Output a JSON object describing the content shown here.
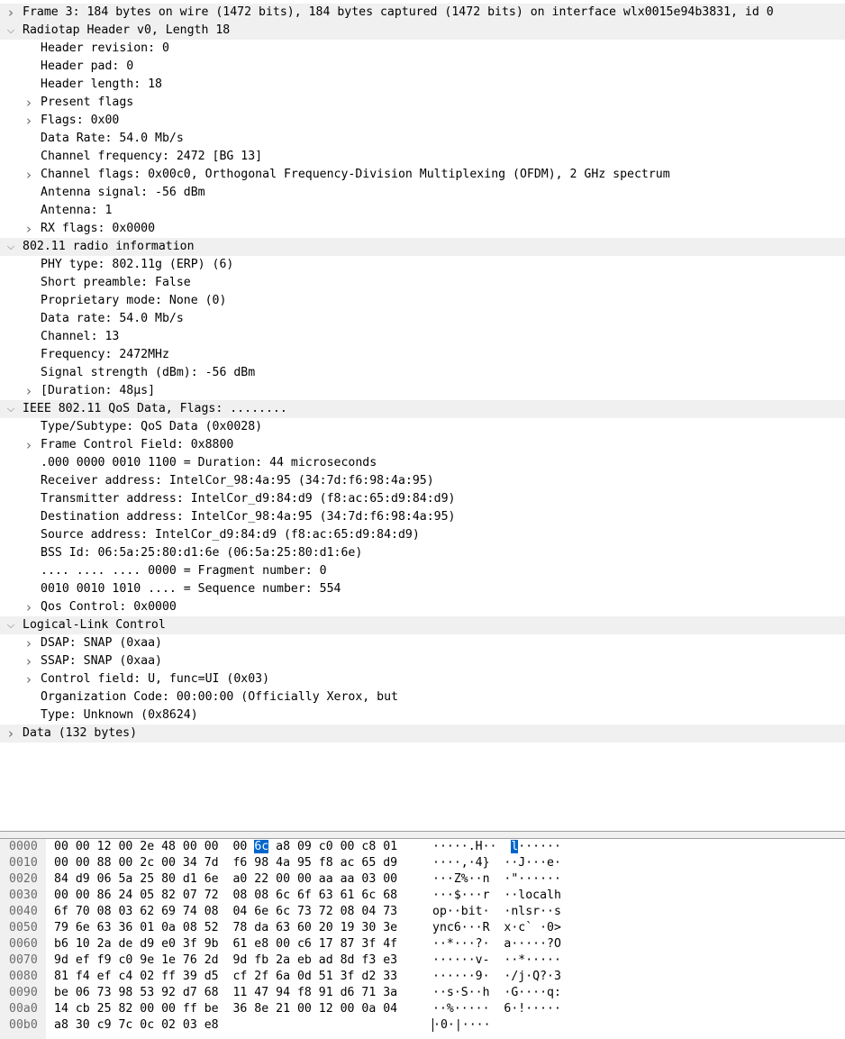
{
  "detail_pane": {
    "rows": [
      {
        "indent": 0,
        "arrow": "collapsed",
        "text": "Frame 3: 184 bytes on wire (1472 bits), 184 bytes captured (1472 bits) on interface wlx0015e94b3831, id 0"
      },
      {
        "indent": 0,
        "arrow": "expanded",
        "text": "Radiotap Header v0, Length 18"
      },
      {
        "indent": 1,
        "arrow": "none",
        "text": "Header revision: 0"
      },
      {
        "indent": 1,
        "arrow": "none",
        "text": "Header pad: 0"
      },
      {
        "indent": 1,
        "arrow": "none",
        "text": "Header length: 18"
      },
      {
        "indent": 1,
        "arrow": "collapsed",
        "text": "Present flags"
      },
      {
        "indent": 1,
        "arrow": "collapsed",
        "text": "Flags: 0x00"
      },
      {
        "indent": 1,
        "arrow": "none",
        "text": "Data Rate: 54.0 Mb/s"
      },
      {
        "indent": 1,
        "arrow": "none",
        "text": "Channel frequency: 2472 [BG 13]"
      },
      {
        "indent": 1,
        "arrow": "collapsed",
        "text": "Channel flags: 0x00c0, Orthogonal Frequency-Division Multiplexing (OFDM), 2 GHz spectrum"
      },
      {
        "indent": 1,
        "arrow": "none",
        "text": "Antenna signal: -56 dBm"
      },
      {
        "indent": 1,
        "arrow": "none",
        "text": "Antenna: 1"
      },
      {
        "indent": 1,
        "arrow": "collapsed",
        "text": "RX flags: 0x0000"
      },
      {
        "indent": 0,
        "arrow": "expanded",
        "text": "802.11 radio information"
      },
      {
        "indent": 1,
        "arrow": "none",
        "text": "PHY type: 802.11g (ERP) (6)"
      },
      {
        "indent": 1,
        "arrow": "none",
        "text": "Short preamble: False"
      },
      {
        "indent": 1,
        "arrow": "none",
        "text": "Proprietary mode: None (0)"
      },
      {
        "indent": 1,
        "arrow": "none",
        "text": "Data rate: 54.0 Mb/s"
      },
      {
        "indent": 1,
        "arrow": "none",
        "text": "Channel: 13"
      },
      {
        "indent": 1,
        "arrow": "none",
        "text": "Frequency: 2472MHz"
      },
      {
        "indent": 1,
        "arrow": "none",
        "text": "Signal strength (dBm): -56 dBm"
      },
      {
        "indent": 1,
        "arrow": "collapsed",
        "text": "[Duration: 48µs]"
      },
      {
        "indent": 0,
        "arrow": "expanded",
        "text": "IEEE 802.11 QoS Data, Flags: ........"
      },
      {
        "indent": 1,
        "arrow": "none",
        "text": "Type/Subtype: QoS Data (0x0028)"
      },
      {
        "indent": 1,
        "arrow": "collapsed",
        "text": "Frame Control Field: 0x8800"
      },
      {
        "indent": 1,
        "arrow": "none",
        "text": ".000 0000 0010 1100 = Duration: 44 microseconds"
      },
      {
        "indent": 1,
        "arrow": "none",
        "text": "Receiver address: IntelCor_98:4a:95 (34:7d:f6:98:4a:95)"
      },
      {
        "indent": 1,
        "arrow": "none",
        "text": "Transmitter address: IntelCor_d9:84:d9 (f8:ac:65:d9:84:d9)"
      },
      {
        "indent": 1,
        "arrow": "none",
        "text": "Destination address: IntelCor_98:4a:95 (34:7d:f6:98:4a:95)"
      },
      {
        "indent": 1,
        "arrow": "none",
        "text": "Source address: IntelCor_d9:84:d9 (f8:ac:65:d9:84:d9)"
      },
      {
        "indent": 1,
        "arrow": "none",
        "text": "BSS Id: 06:5a:25:80:d1:6e (06:5a:25:80:d1:6e)"
      },
      {
        "indent": 1,
        "arrow": "none",
        "text": ".... .... .... 0000 = Fragment number: 0"
      },
      {
        "indent": 1,
        "arrow": "none",
        "text": "0010 0010 1010 .... = Sequence number: 554"
      },
      {
        "indent": 1,
        "arrow": "collapsed",
        "text": "Qos Control: 0x0000"
      },
      {
        "indent": 0,
        "arrow": "expanded",
        "text": "Logical-Link Control"
      },
      {
        "indent": 1,
        "arrow": "collapsed",
        "text": "DSAP: SNAP (0xaa)"
      },
      {
        "indent": 1,
        "arrow": "collapsed",
        "text": "SSAP: SNAP (0xaa)"
      },
      {
        "indent": 1,
        "arrow": "collapsed",
        "text": "Control field: U, func=UI (0x03)"
      },
      {
        "indent": 1,
        "arrow": "none",
        "text": "Organization Code: 00:00:00 (Officially Xerox, but"
      },
      {
        "indent": 1,
        "arrow": "none",
        "text": "Type: Unknown (0x8624)"
      },
      {
        "indent": 0,
        "arrow": "collapsed",
        "text": "Data (132 bytes)"
      }
    ]
  },
  "bytes_pane": {
    "rows": [
      {
        "offset": "0000",
        "hex": [
          "00 00 12 00 2e 48 00 00  00 ",
          "6c",
          " a8 09 c0 00 c8 01"
        ],
        "ascii": [
          "·····.H··  ",
          "l",
          "······"
        ]
      },
      {
        "offset": "0010",
        "hex": [
          "00 00 88 00 2c 00 34 7d  f6 98 4a 95 f8 ac 65 d9"
        ],
        "ascii": [
          "····,·4}  ··J···e·"
        ]
      },
      {
        "offset": "0020",
        "hex": [
          "84 d9 06 5a 25 80 d1 6e  a0 22 00 00 aa aa 03 00"
        ],
        "ascii": [
          "···Z%··n  ·\"······"
        ]
      },
      {
        "offset": "0030",
        "hex": [
          "00 00 86 24 05 82 07 72  08 08 6c 6f 63 61 6c 68"
        ],
        "ascii": [
          "···$···r  ··localh"
        ]
      },
      {
        "offset": "0040",
        "hex": [
          "6f 70 08 03 62 69 74 08  04 6e 6c 73 72 08 04 73"
        ],
        "ascii": [
          "op··bit·  ·nlsr··s"
        ]
      },
      {
        "offset": "0050",
        "hex": [
          "79 6e 63 36 01 0a 08 52  78 da 63 60 20 19 30 3e"
        ],
        "ascii": [
          "ync6···R  x·c` ·0>"
        ]
      },
      {
        "offset": "0060",
        "hex": [
          "b6 10 2a de d9 e0 3f 9b  61 e8 00 c6 17 87 3f 4f"
        ],
        "ascii": [
          "··*···?·  a·····?O"
        ]
      },
      {
        "offset": "0070",
        "hex": [
          "9d ef f9 c0 9e 1e 76 2d  9d fb 2a eb ad 8d f3 e3"
        ],
        "ascii": [
          "······v-  ··*·····"
        ]
      },
      {
        "offset": "0080",
        "hex": [
          "81 f4 ef c4 02 ff 39 d5  cf 2f 6a 0d 51 3f d2 33"
        ],
        "ascii": [
          "······9·  ·/j·Q?·3"
        ]
      },
      {
        "offset": "0090",
        "hex": [
          "be 06 73 98 53 92 d7 68  11 47 94 f8 91 d6 71 3a"
        ],
        "ascii": [
          "··s·S··h  ·G····q:"
        ]
      },
      {
        "offset": "00a0",
        "hex": [
          "14 cb 25 82 00 00 ff be  36 8e 21 00 12 00 0a 04"
        ],
        "ascii": [
          "··%·····  6·!·····"
        ]
      },
      {
        "offset": "00b0",
        "hex": [
          "a8 30 c9 7c 0c 02 03 e8"
        ],
        "ascii": [
          "·0·|····"
        ]
      }
    ]
  }
}
